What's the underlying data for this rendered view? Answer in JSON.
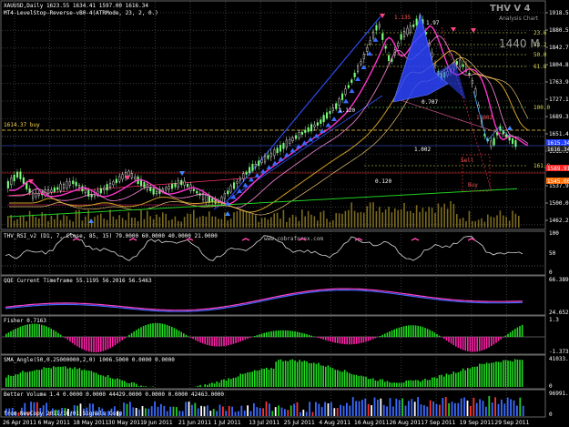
{
  "header": {
    "line1": "XAUUSD,Daily  1623.55 1634.41 1597.00 1616.34",
    "line2": "MT4-LevelStop-Reverse-vB0-4(ATRMode, 23, 2, 0.)",
    "buy_label": "1614.37 buy"
  },
  "watermark": {
    "brand": "THV V 4",
    "sub": "Analysis Chart",
    "price": "1440 M"
  },
  "site": "www.cobraforex.com",
  "main_axis": [
    "1918.54",
    "1880.55",
    "1842.70",
    "1804.85",
    "1763.90",
    "1727.15",
    "1689.30",
    "1651.45",
    "1613.60",
    "1575.75",
    "1537.90",
    "1500.05",
    "1462.20"
  ],
  "main_axis_tags": [
    {
      "text": "1615.34",
      "color": "#1f3cff"
    },
    {
      "text": "1616.34",
      "color": "#222"
    },
    {
      "text": "1589.91",
      "color": "#ff2222"
    },
    {
      "text": "1545.00",
      "color": "#ff6b00"
    }
  ],
  "fib_labels": [
    "23.6",
    "38.2",
    "50.0",
    "61.8",
    "100.0",
    "161.8"
  ],
  "pattern_labels": {
    "top1": "1.135",
    "top2": "1.97",
    "mid1": "1.120",
    "mid2": "1.002",
    "mid3": "0.707",
    "low1": "1.002",
    "low2": "0.120",
    "note1": "Sell",
    "note2": "Buy"
  },
  "panels": [
    {
      "id": "rsi",
      "title": "THV_RSI_v2  (D1, 7, Close, 85, 15) 79.0000 60.0000 40.0000 21.0000",
      "axis": [
        "100",
        "50",
        "0"
      ]
    },
    {
      "id": "qqe",
      "title": "QQE Current Timeframe 55.1195 56.2016 56.5463",
      "axis": [
        "66.389",
        "24.6525"
      ]
    },
    {
      "id": "fisher",
      "title": "Fisher 0.7163",
      "axis": [
        "1.3",
        "-1.3737"
      ]
    },
    {
      "id": "sma",
      "title": "SMA_Angle(50,0.25000000,2,0) 1006.5000 0.0000 0.0000",
      "axis": [
        "41033.88",
        "0"
      ]
    },
    {
      "id": "vol",
      "title": "Better Volume 1.4  0.0000 0.0000 44429.0000 0.0000 0.0000 42463.0000",
      "axis": [
        "96991.15",
        "0"
      ]
    }
  ],
  "vol_footer": "from NewCopy 2011/10/01 Signals Corp",
  "dates": [
    "26 Apr 2011",
    "6 May 2011",
    "18 May 2011",
    "30 May 2011",
    "9 Jun 2011",
    "21 Jun 2011",
    "1 Jul 2011",
    "13 Jul 2011",
    "25 Jul 2011",
    "4 Aug 2011",
    "16 Aug 2011",
    "26 Aug 2011",
    "7 Sep 2011",
    "19 Sep 2011",
    "29 Sep 2011"
  ],
  "colors": {
    "up": "#7cff7c",
    "down": "#ffffff",
    "ma_fast": "#ff33cc",
    "ma_mid": "#d4a028",
    "ma_slow": "#22cc22",
    "blue": "#3050ff",
    "bg": "#000000",
    "grid": "#3a3a3a"
  }
}
